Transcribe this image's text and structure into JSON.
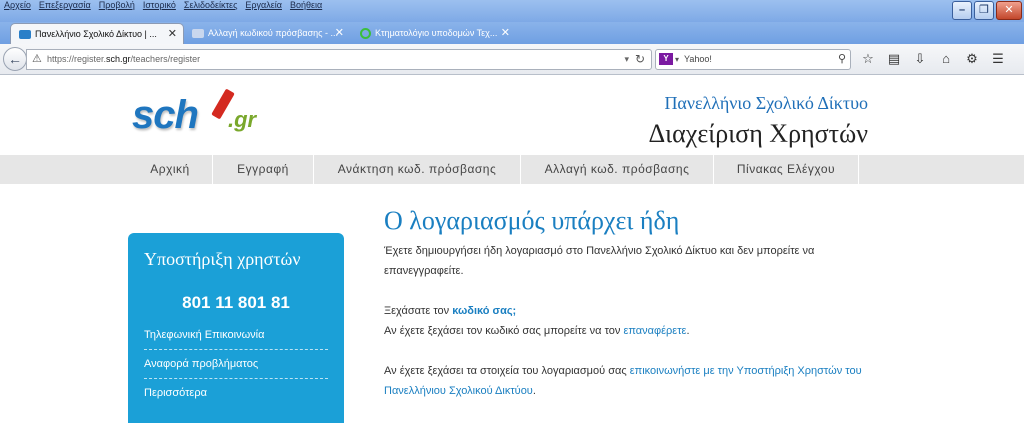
{
  "browser": {
    "menu": [
      "Αρχείο",
      "Επεξεργασία",
      "Προβολή",
      "Ιστορικό",
      "Σελιδοδείκτες",
      "Εργαλεία",
      "Βοήθεια"
    ],
    "tabs": [
      {
        "label": "Πανελλήνιο Σχολικό Δίκτυο | ...",
        "active": true
      },
      {
        "label": "Αλλαγή κωδικού πρόσβασης - ...",
        "active": false
      },
      {
        "label": "Κτηματολόγιο υποδομών Τεχ...",
        "active": false
      }
    ],
    "url_prefix": "https://register.",
    "url_host": "sch.gr",
    "url_path": "/teachers/register",
    "search_placeholder": "Yahoo!",
    "search_engine_letter": "Y"
  },
  "header": {
    "logo_text": "sch",
    "logo_suffix": ".gr",
    "subtitle": "Πανελλήνιο Σχολικό Δίκτυο",
    "title": "Διαχείριση Χρηστών"
  },
  "nav": {
    "items": [
      "Αρχική",
      "Εγγραφή",
      "Ανάκτηση κωδ. πρόσβασης",
      "Αλλαγή κωδ. πρόσβασης",
      "Πίνακας Ελέγχου"
    ]
  },
  "sidebar": {
    "title": "Υποστήριξη χρηστών",
    "phone": "801 11 801 81",
    "links": [
      "Τηλεφωνική Επικοινωνία",
      "Αναφορά προβλήματος",
      "Περισσότερα"
    ]
  },
  "main": {
    "title": "Ο λογαριασμός υπάρχει ήδη",
    "p1": "Έχετε δημιουργήσει ήδη λογαριασμό στο Πανελλήνιο Σχολικό Δίκτυο και δεν μπορείτε να επανεγγραφείτε.",
    "p2_prefix": "Ξεχάσατε τον ",
    "p2_link": "κωδικό σας;",
    "p3_prefix": "Αν έχετε ξεχάσει τον κωδικό σας μπορείτε να τον ",
    "p3_link": "επαναφέρετε",
    "p3_suffix": ".",
    "p4_prefix": "Αν έχετε ξεχάσει τα στοιχεία του λογαριασμού σας ",
    "p4_link": "επικοινωνήστε με την Υποστήριξη Χρηστών του Πανελλήνιου Σχολικού Δικτύου",
    "p4_suffix": "."
  },
  "colors": {
    "accent": "#1a7fc1",
    "sidebar": "#1ba0d7",
    "nav_bg": "#e6e6e6"
  }
}
